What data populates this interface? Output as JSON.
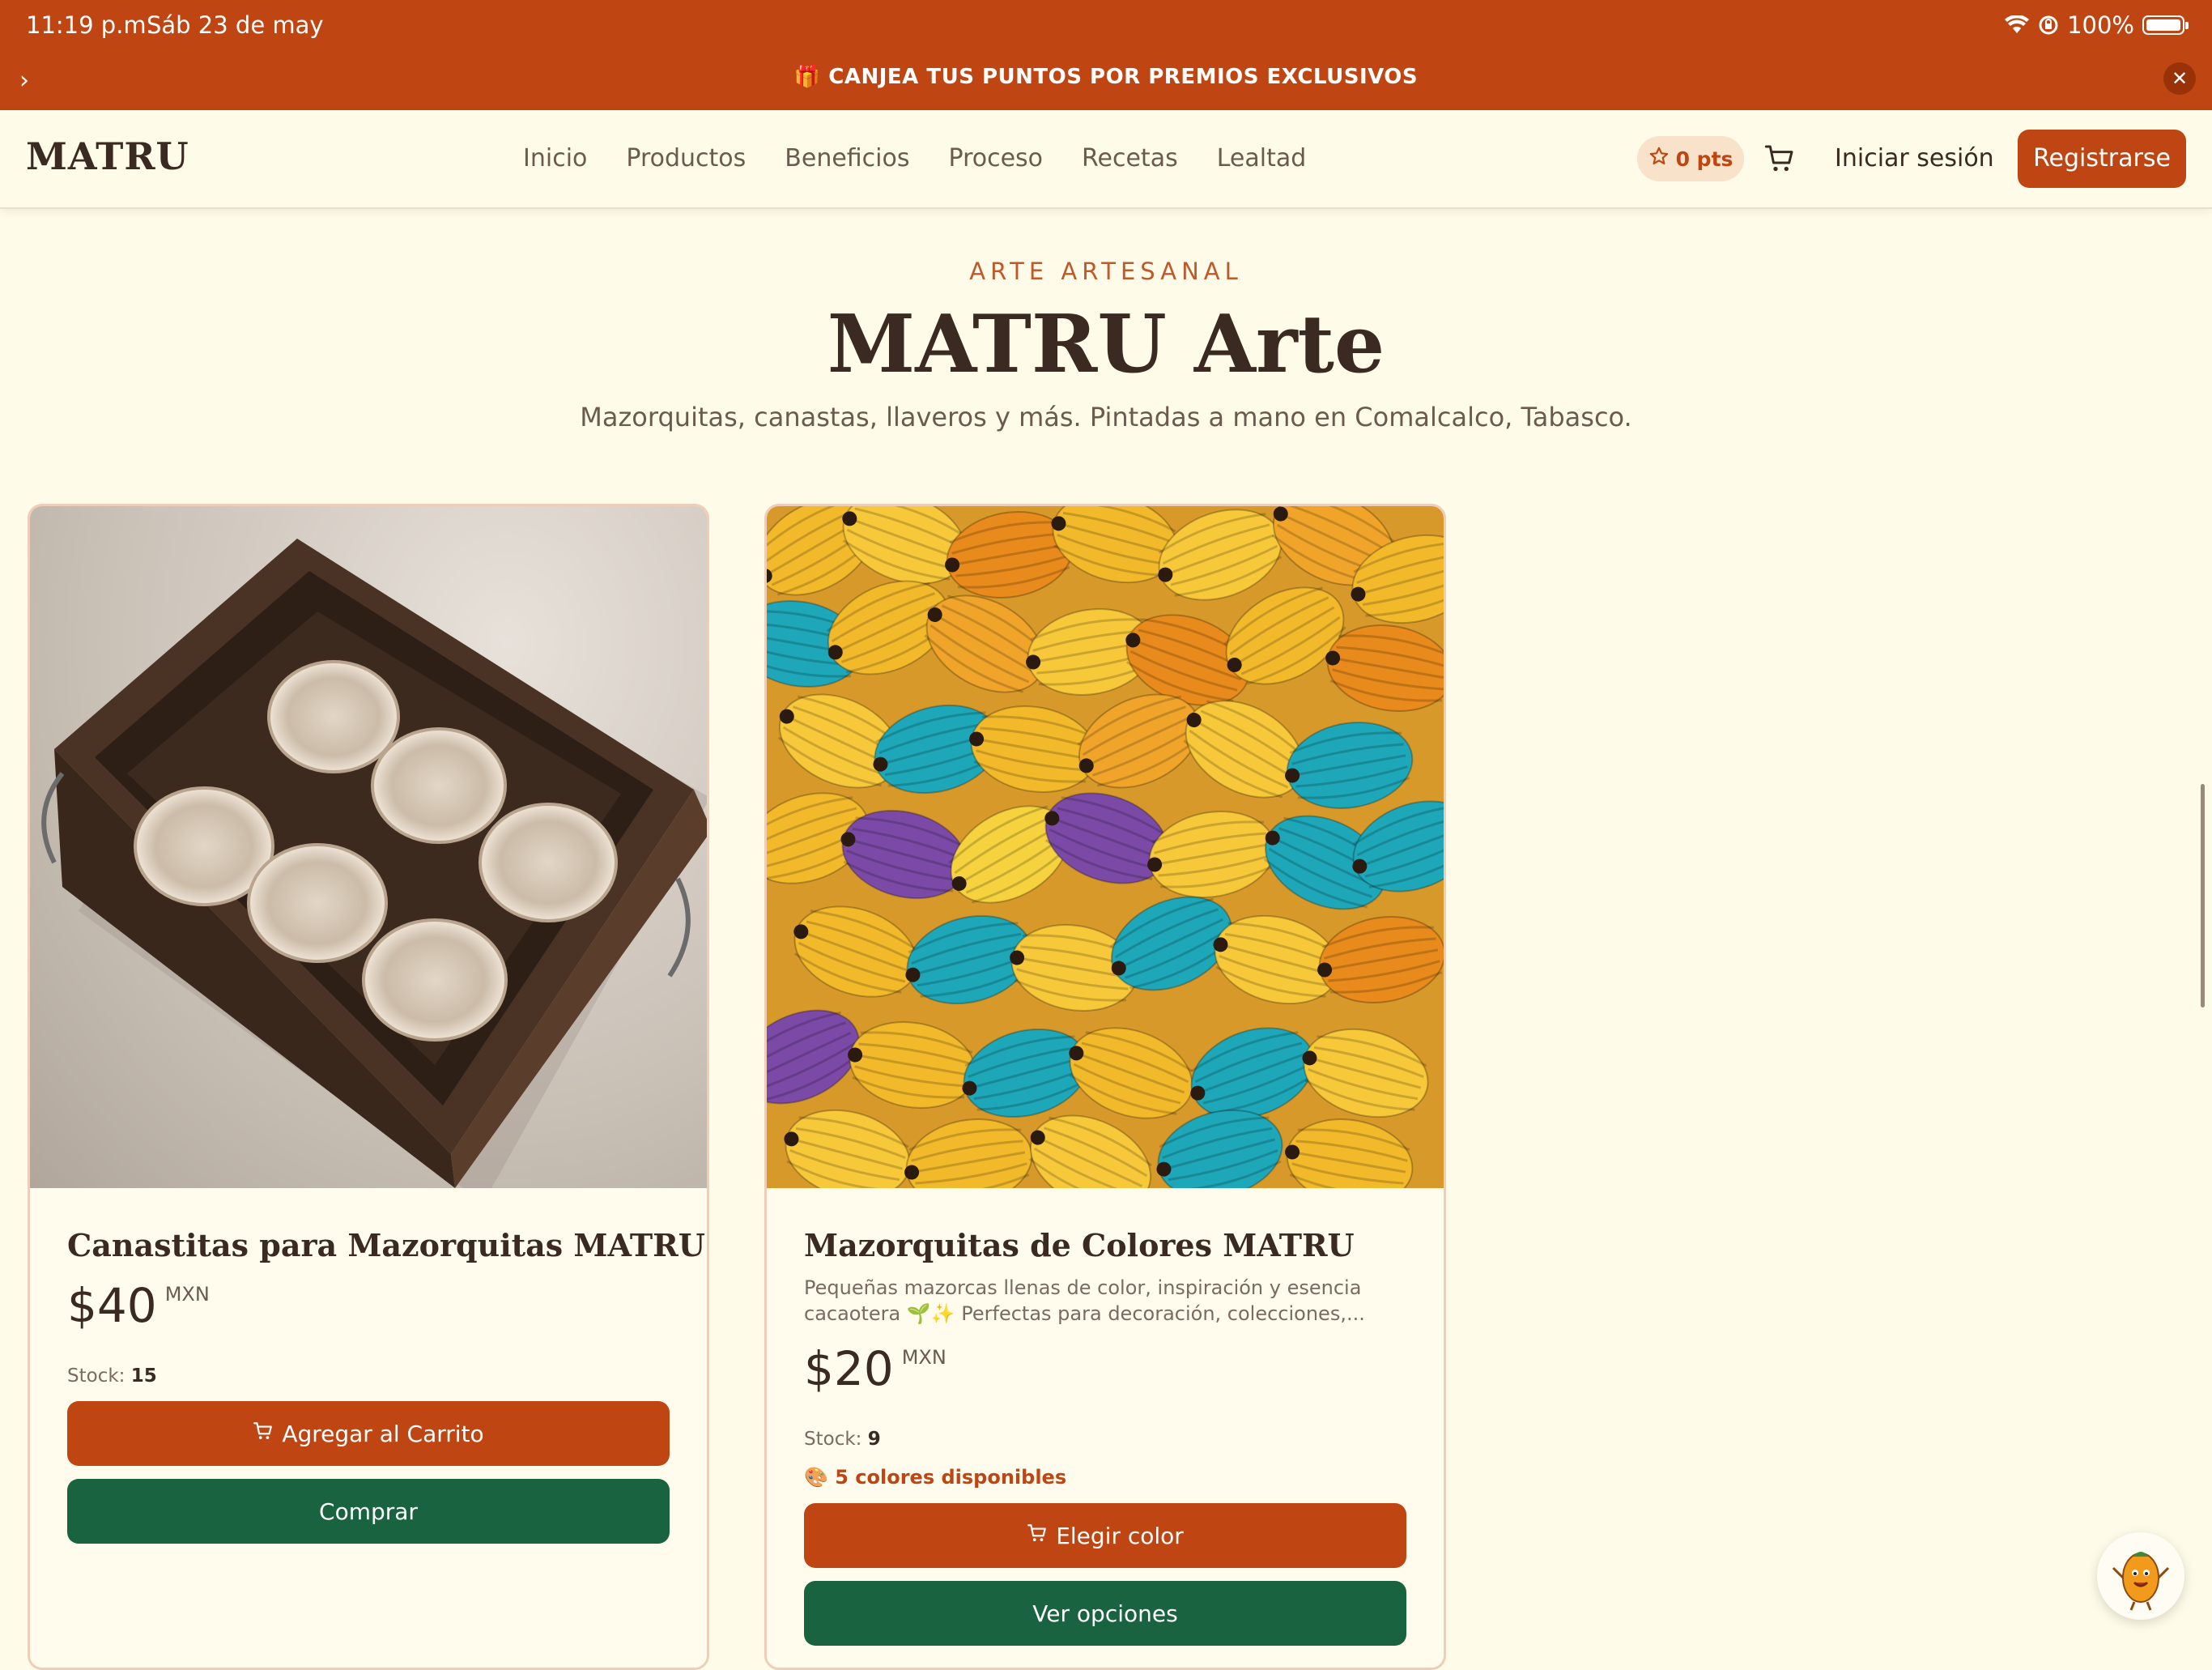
{
  "status_bar": {
    "time": "11:19 p.m.",
    "date": "Sáb 23 de may",
    "battery": "100%"
  },
  "promo": {
    "text": "🎁 CANJEA TUS PUNTOS POR PREMIOS EXCLUSIVOS",
    "chevron": "›",
    "close": "✕"
  },
  "nav": {
    "logo": "MATRU",
    "links": [
      "Inicio",
      "Productos",
      "Beneficios",
      "Proceso",
      "Recetas",
      "Lealtad"
    ],
    "points": "0 pts",
    "login": "Iniciar sesión",
    "register": "Registrarse"
  },
  "section": {
    "eyebrow": "ARTE ARTESANAL",
    "title": "MATRU Arte",
    "subtitle": "Mazorquitas, canastas, llaveros y más. Pintadas a mano en Comalcalco, Tabasco."
  },
  "products": [
    {
      "title": "Canastitas para Mazorquitas MATRU",
      "price": "$40",
      "currency": "MXN",
      "stock_label": "Stock:",
      "stock": "15",
      "primary_button": "Agregar al  Carrito",
      "secondary_button": "Comprar"
    },
    {
      "title": "Mazorquitas de Colores MATRU",
      "description": "Pequeñas mazorcas llenas de color, inspiración y esencia cacaotera 🌱✨ Perfectas para decoración, colecciones,...",
      "price": "$20",
      "currency": "MXN",
      "stock_label": "Stock:",
      "stock": "9",
      "colors": "🎨 5 colores disponibles",
      "primary_button": "Elegir color",
      "secondary_button": "Ver opciones"
    }
  ],
  "colors": {
    "brand_orange": "#bf4612",
    "brand_green": "#196341",
    "background": "#fefbe8",
    "text_dark": "#3b2a22"
  },
  "icons": {
    "wifi": "wifi-icon",
    "lock_rotation": "lock-rotation-icon",
    "battery": "battery-icon",
    "star": "star-icon",
    "cart": "cart-icon",
    "close": "close-icon",
    "mascot": "cacao-mascot-icon"
  }
}
